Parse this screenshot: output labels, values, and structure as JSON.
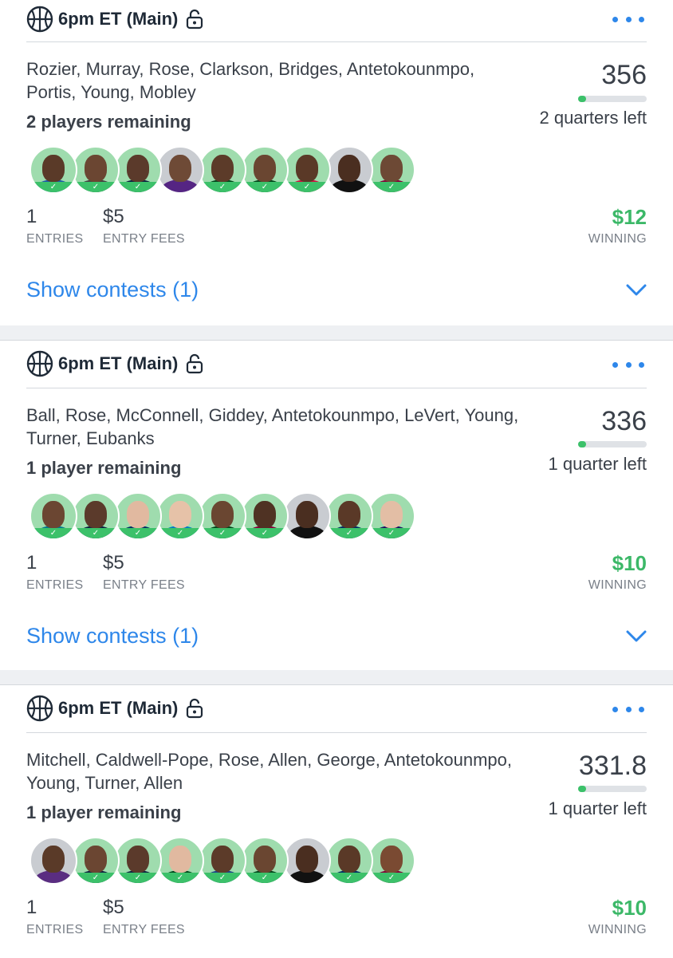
{
  "cards": [
    {
      "slate": "6pm ET (Main)",
      "players": "Rozier, Murray, Rose, Clarkson, Bridges, Antetokounmpo, Portis, Young, Mobley",
      "remaining": "2 players remaining",
      "score": "356",
      "progress": 0.12,
      "time_left": "2 quarters left",
      "entries": "1",
      "entries_label": "ENTRIES",
      "fee": "$5",
      "fee_label": "ENTRY FEES",
      "winning": "$12",
      "winning_label": "WINNING",
      "show": "Show contests (1)",
      "avatars": [
        {
          "done": true,
          "skin": "#5a3a28",
          "shirt": "#1e5aa8"
        },
        {
          "done": true,
          "skin": "#6b4632",
          "shirt": "#444"
        },
        {
          "done": true,
          "skin": "#5b3a2b",
          "shirt": "#0c2340"
        },
        {
          "done": false,
          "skin": "#6e4a36",
          "shirt": "#552583"
        },
        {
          "done": true,
          "skin": "#5c3b29",
          "shirt": "#00471b"
        },
        {
          "done": true,
          "skin": "#6a4631",
          "shirt": "#00471b"
        },
        {
          "done": true,
          "skin": "#5a3927",
          "shirt": "#ce1141"
        },
        {
          "done": false,
          "skin": "#4a2e20",
          "shirt": "#111"
        },
        {
          "done": true,
          "skin": "#6d4935",
          "shirt": "#860038"
        }
      ]
    },
    {
      "slate": "6pm ET (Main)",
      "players": "Ball, Rose, McConnell, Giddey, Antetokounmpo, LeVert, Young, Turner, Eubanks",
      "remaining": "1 player remaining",
      "score": "336",
      "progress": 0.12,
      "time_left": "1 quarter left",
      "entries": "1",
      "entries_label": "ENTRIES",
      "fee": "$5",
      "fee_label": "ENTRY FEES",
      "winning": "$10",
      "winning_label": "WINNING",
      "show": "Show contests (1)",
      "avatars": [
        {
          "done": true,
          "skin": "#6b4632",
          "shirt": "#00788c"
        },
        {
          "done": true,
          "skin": "#5b3a2b",
          "shirt": "#0c2340"
        },
        {
          "done": true,
          "skin": "#e1b9a0",
          "shirt": "#002d62"
        },
        {
          "done": true,
          "skin": "#e6c2a8",
          "shirt": "#007ac1"
        },
        {
          "done": true,
          "skin": "#6a4631",
          "shirt": "#00471b"
        },
        {
          "done": true,
          "skin": "#4f3223",
          "shirt": "#860038"
        },
        {
          "done": false,
          "skin": "#4a2e20",
          "shirt": "#111"
        },
        {
          "done": true,
          "skin": "#5a3927",
          "shirt": "#002d62"
        },
        {
          "done": true,
          "skin": "#e3bea5",
          "shirt": "#1d1160"
        }
      ]
    },
    {
      "slate": "6pm ET (Main)",
      "players": "Mitchell, Caldwell-Pope, Rose, Allen, George, Antetokounmpo, Young, Turner, Allen",
      "remaining": "1 player remaining",
      "score": "331.8",
      "progress": 0.12,
      "time_left": "1 quarter left",
      "entries": "1",
      "entries_label": "ENTRIES",
      "fee": "$5",
      "fee_label": "ENTRY FEES",
      "winning": "$10",
      "winning_label": "WINNING",
      "show": "",
      "avatars": [
        {
          "done": false,
          "skin": "#5a3a28",
          "shirt": "#5a2d81"
        },
        {
          "done": true,
          "skin": "#6b4632",
          "shirt": "#0e2240"
        },
        {
          "done": true,
          "skin": "#5b3a2b",
          "shirt": "#0c2340"
        },
        {
          "done": true,
          "skin": "#e1b9a0",
          "shirt": "#00471b"
        },
        {
          "done": true,
          "skin": "#5c3b29",
          "shirt": "#1d428a"
        },
        {
          "done": true,
          "skin": "#6a4631",
          "shirt": "#00471b"
        },
        {
          "done": false,
          "skin": "#4a2e20",
          "shirt": "#111"
        },
        {
          "done": true,
          "skin": "#5a3927",
          "shirt": "#002d62"
        },
        {
          "done": true,
          "skin": "#7a4a32",
          "shirt": "#860038"
        }
      ]
    }
  ],
  "colors": {
    "accent": "#2e87ea",
    "win": "#3cb868",
    "check": "#3cc16a"
  }
}
